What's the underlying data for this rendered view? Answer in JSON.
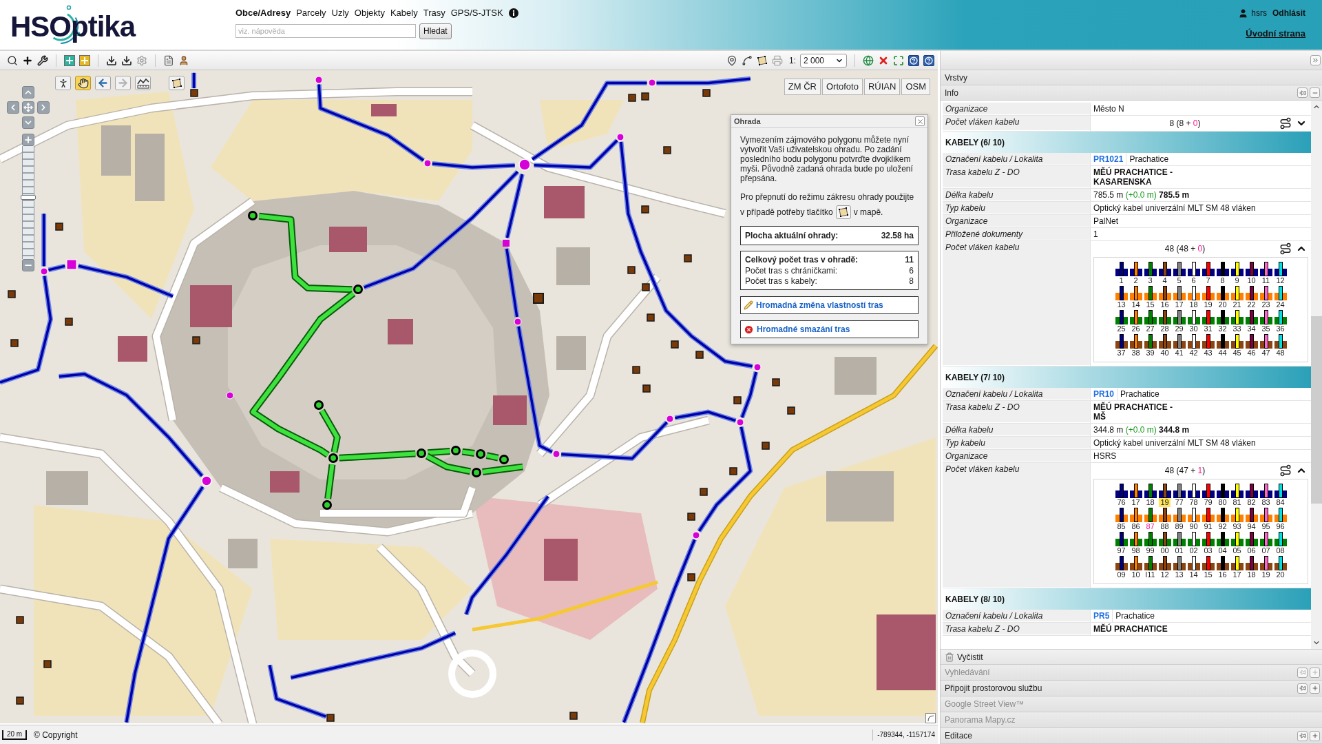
{
  "header": {
    "logo": "HSOptika",
    "nav": [
      {
        "label": "Obce/Adresy",
        "selected": true
      },
      {
        "label": "Parcely",
        "selected": false
      },
      {
        "label": "Uzly",
        "selected": false
      },
      {
        "label": "Objekty",
        "selected": false
      },
      {
        "label": "Kabely",
        "selected": false
      },
      {
        "label": "Trasy",
        "selected": false
      },
      {
        "label": "GPS/S-JTSK",
        "selected": false
      }
    ],
    "search": {
      "placeholder": "viz. nápověda"
    },
    "search_button": "Hledat",
    "user": "hsrs",
    "logout": "Odhlásit",
    "home_link": "Úvodní strana"
  },
  "map": {
    "scale": {
      "prefix": "1:",
      "value": "2 000"
    },
    "tools": [
      {
        "kind": "pegman",
        "selected": false,
        "disabled": false
      },
      {
        "kind": "pan",
        "selected": true,
        "disabled": false
      },
      {
        "kind": "back",
        "selected": false,
        "disabled": false
      },
      {
        "kind": "forward",
        "selected": false,
        "disabled": true
      },
      {
        "kind": "measure",
        "selected": false,
        "disabled": false
      },
      {
        "kind": "polygon",
        "selected": false,
        "disabled": false
      }
    ],
    "zoom_slider": {
      "level": 0.55
    },
    "layers": [
      "ZM ČR",
      "Ortofoto",
      "RÚIAN",
      "OSM"
    ],
    "fence_dialog": {
      "title": "Ohrada",
      "text": "Vymezením zájmového polygonu můžete nyní vytvořit Vaši uživatelskou ohradu. Po zadání posledního bodu polygonu potvrďte dvojklikem myši. Původně zadaná ohrada bude po uložení přepsána.",
      "hint_intro": "Pro přepnutí do režimu zákresu ohrady použijte",
      "hint_before": "v případě potřeby tlačítko",
      "hint_after": "v mapě.",
      "area": {
        "label": "Plocha aktuální ohrady:",
        "value": "32.58 ha"
      },
      "counts": [
        {
          "kind": "total",
          "label": "Celkový počet tras v ohradě:",
          "value": "11"
        },
        {
          "kind": "detail",
          "label": "Počet tras s chráničkami:",
          "value": "6"
        },
        {
          "kind": "detail",
          "label": "Počet tras s kabely:",
          "value": "8"
        }
      ],
      "actions": [
        {
          "kind": "edit",
          "label": "Hromadná změna vlastností tras"
        },
        {
          "kind": "delete",
          "label": "Hromadné smazání tras"
        }
      ]
    }
  },
  "status_bar": {
    "scale_bar": "20 m",
    "copyright": "© Copyright",
    "coordinates": "-789344, -1157174"
  },
  "side_panel": {
    "panels": [
      {
        "title": "Vrstvy",
        "pin_controls": false,
        "disabled": false
      },
      {
        "title": "Info",
        "pin_controls": true,
        "expanded": true,
        "disabled": false,
        "clear_button": "Vyčistit",
        "sections": [
          {
            "rows": [
              {
                "kind": "text",
                "label": "Organizace",
                "value": "Město N"
              },
              {
                "kind": "fibers",
                "label": "Počet vláken kabelu",
                "count": {
                  "before": "8 (8 + ",
                  "extra": "0",
                  "after": ")"
                },
                "expanded": false
              }
            ]
          },
          {
            "title": "KABELY (6/ 10)",
            "rows": [
              {
                "kind": "cable",
                "label": "Označení kabelu / Lokalita",
                "cable": "PR1021",
                "locality": "Prachatice"
              },
              {
                "kind": "route",
                "label": "Trasa kabelu Z - DO",
                "lines": [
                  "MĚÚ PRACHATICE -",
                  "KASARENSKA"
                ]
              },
              {
                "kind": "length",
                "label": "Délka kabelu",
                "value": "785.5 m",
                "delta": "(+0.0 m)",
                "total": "785.5 m"
              },
              {
                "kind": "text",
                "label": "Typ kabelu",
                "value": "Optický kabel univerzální MLT SM 48 vláken"
              },
              {
                "kind": "text",
                "label": "Organizace",
                "value": "PalNet"
              },
              {
                "kind": "text",
                "label": "Přiložené dokumenty",
                "value": "1"
              },
              {
                "kind": "fibers",
                "label": "Počet vláken kabelu",
                "count": {
                  "before": "48 (48 + ",
                  "extra": "0",
                  "after": ")"
                },
                "expanded": true,
                "tubes": [
                  {
                    "color": "#000080",
                    "fibers": [
                      {
                        "label": "1",
                        "color": "#000080",
                        "highlighted": false,
                        "flagged": false
                      },
                      {
                        "label": "2",
                        "color": "#ff8000",
                        "highlighted": false,
                        "flagged": false
                      },
                      {
                        "label": "3",
                        "color": "#008000",
                        "highlighted": false,
                        "flagged": false
                      },
                      {
                        "label": "4",
                        "color": "#8b4513",
                        "highlighted": false,
                        "flagged": false
                      },
                      {
                        "label": "5",
                        "color": "#808080",
                        "highlighted": false,
                        "flagged": false
                      },
                      {
                        "label": "6",
                        "color": "#ffffff",
                        "highlighted": false,
                        "flagged": false
                      },
                      {
                        "label": "7",
                        "color": "#ff0000",
                        "highlighted": false,
                        "flagged": false
                      },
                      {
                        "label": "8",
                        "color": "#000000",
                        "highlighted": false,
                        "flagged": false
                      },
                      {
                        "label": "9",
                        "color": "#ffff00",
                        "highlighted": false,
                        "flagged": false
                      },
                      {
                        "label": "10",
                        "color": "#800040",
                        "highlighted": false,
                        "flagged": false
                      },
                      {
                        "label": "11",
                        "color": "#ff66cc",
                        "highlighted": false,
                        "flagged": false
                      },
                      {
                        "label": "12",
                        "color": "#00e0e0",
                        "highlighted": false,
                        "flagged": false
                      }
                    ]
                  },
                  {
                    "color": "#ff8000",
                    "fibers": [
                      {
                        "label": "13",
                        "color": "#000080",
                        "highlighted": false,
                        "flagged": false
                      },
                      {
                        "label": "14",
                        "color": "#ff8000",
                        "highlighted": false,
                        "flagged": false
                      },
                      {
                        "label": "15",
                        "color": "#008000",
                        "highlighted": false,
                        "flagged": false
                      },
                      {
                        "label": "16",
                        "color": "#8b4513",
                        "highlighted": false,
                        "flagged": false
                      },
                      {
                        "label": "17",
                        "color": "#808080",
                        "highlighted": false,
                        "flagged": false
                      },
                      {
                        "label": "18",
                        "color": "#ffffff",
                        "highlighted": false,
                        "flagged": false
                      },
                      {
                        "label": "19",
                        "color": "#ff0000",
                        "highlighted": false,
                        "flagged": false
                      },
                      {
                        "label": "20",
                        "color": "#000000",
                        "highlighted": false,
                        "flagged": false
                      },
                      {
                        "label": "21",
                        "color": "#ffff00",
                        "highlighted": false,
                        "flagged": false
                      },
                      {
                        "label": "22",
                        "color": "#800040",
                        "highlighted": false,
                        "flagged": false
                      },
                      {
                        "label": "23",
                        "color": "#ff66cc",
                        "highlighted": false,
                        "flagged": false
                      },
                      {
                        "label": "24",
                        "color": "#00e0e0",
                        "highlighted": false,
                        "flagged": false
                      }
                    ]
                  },
                  {
                    "color": "#008000",
                    "fibers": [
                      {
                        "label": "25",
                        "color": "#000080",
                        "highlighted": false,
                        "flagged": false
                      },
                      {
                        "label": "26",
                        "color": "#ff8000",
                        "highlighted": false,
                        "flagged": false
                      },
                      {
                        "label": "27",
                        "color": "#008000",
                        "highlighted": false,
                        "flagged": false
                      },
                      {
                        "label": "28",
                        "color": "#8b4513",
                        "highlighted": false,
                        "flagged": false
                      },
                      {
                        "label": "29",
                        "color": "#808080",
                        "highlighted": false,
                        "flagged": false
                      },
                      {
                        "label": "30",
                        "color": "#ffffff",
                        "highlighted": false,
                        "flagged": false
                      },
                      {
                        "label": "31",
                        "color": "#ff0000",
                        "highlighted": false,
                        "flagged": false
                      },
                      {
                        "label": "32",
                        "color": "#000000",
                        "highlighted": false,
                        "flagged": false
                      },
                      {
                        "label": "33",
                        "color": "#ffff00",
                        "highlighted": false,
                        "flagged": false
                      },
                      {
                        "label": "34",
                        "color": "#800040",
                        "highlighted": false,
                        "flagged": false
                      },
                      {
                        "label": "35",
                        "color": "#ff66cc",
                        "highlighted": false,
                        "flagged": false
                      },
                      {
                        "label": "36",
                        "color": "#00e0e0",
                        "highlighted": false,
                        "flagged": false
                      }
                    ]
                  },
                  {
                    "color": "#8b4513",
                    "fibers": [
                      {
                        "label": "37",
                        "color": "#000080",
                        "highlighted": false,
                        "flagged": false
                      },
                      {
                        "label": "38",
                        "color": "#ff8000",
                        "highlighted": false,
                        "flagged": false
                      },
                      {
                        "label": "39",
                        "color": "#008000",
                        "highlighted": false,
                        "flagged": false
                      },
                      {
                        "label": "40",
                        "color": "#8b4513",
                        "highlighted": false,
                        "flagged": false
                      },
                      {
                        "label": "41",
                        "color": "#808080",
                        "highlighted": false,
                        "flagged": false
                      },
                      {
                        "label": "42",
                        "color": "#ffffff",
                        "highlighted": false,
                        "flagged": false
                      },
                      {
                        "label": "43",
                        "color": "#ff0000",
                        "highlighted": false,
                        "flagged": false
                      },
                      {
                        "label": "44",
                        "color": "#000000",
                        "highlighted": false,
                        "flagged": false
                      },
                      {
                        "label": "45",
                        "color": "#ffff00",
                        "highlighted": false,
                        "flagged": false
                      },
                      {
                        "label": "46",
                        "color": "#800040",
                        "highlighted": false,
                        "flagged": false
                      },
                      {
                        "label": "47",
                        "color": "#ff66cc",
                        "highlighted": false,
                        "flagged": false
                      },
                      {
                        "label": "48",
                        "color": "#00e0e0",
                        "highlighted": false,
                        "flagged": false
                      }
                    ]
                  }
                ]
              }
            ]
          },
          {
            "title": "KABELY (7/ 10)",
            "rows": [
              {
                "kind": "cable",
                "label": "Označení kabelu / Lokalita",
                "cable": "PR10",
                "locality": "Prachatice"
              },
              {
                "kind": "route",
                "label": "Trasa kabelu Z - DO",
                "lines": [
                  "MĚÚ PRACHATICE -",
                  "MŠ"
                ]
              },
              {
                "kind": "length",
                "label": "Délka kabelu",
                "value": "344.8 m",
                "delta": "(+0.0 m)",
                "total": "344.8 m"
              },
              {
                "kind": "text",
                "label": "Typ kabelu",
                "value": "Optický kabel univerzální MLT SM 48 vláken"
              },
              {
                "kind": "text",
                "label": "Organizace",
                "value": "HSRS"
              },
              {
                "kind": "fibers",
                "label": "Počet vláken kabelu",
                "count": {
                  "before": "48 (47 + ",
                  "extra": "1",
                  "after": ")"
                },
                "expanded": true,
                "tubes": [
                  {
                    "color": "#000080",
                    "fibers": [
                      {
                        "label": "76",
                        "color": "#000080",
                        "highlighted": false,
                        "flagged": false
                      },
                      {
                        "label": "17",
                        "color": "#ff8000",
                        "highlighted": false,
                        "flagged": false
                      },
                      {
                        "label": "18",
                        "color": "#008000",
                        "highlighted": false,
                        "flagged": false
                      },
                      {
                        "label": "19",
                        "color": "#8b4513",
                        "highlighted": true,
                        "flagged": false
                      },
                      {
                        "label": "77",
                        "color": "#808080",
                        "highlighted": false,
                        "flagged": false
                      },
                      {
                        "label": "78",
                        "color": "#ffffff",
                        "highlighted": false,
                        "flagged": false
                      },
                      {
                        "label": "79",
                        "color": "#ff0000",
                        "highlighted": false,
                        "flagged": false
                      },
                      {
                        "label": "80",
                        "color": "#000000",
                        "highlighted": false,
                        "flagged": false
                      },
                      {
                        "label": "81",
                        "color": "#ffff00",
                        "highlighted": false,
                        "flagged": false
                      },
                      {
                        "label": "82",
                        "color": "#800040",
                        "highlighted": false,
                        "flagged": false
                      },
                      {
                        "label": "83",
                        "color": "#ff66cc",
                        "highlighted": false,
                        "flagged": false
                      },
                      {
                        "label": "84",
                        "color": "#00e0e0",
                        "highlighted": false,
                        "flagged": false
                      }
                    ]
                  },
                  {
                    "color": "#ff8000",
                    "fibers": [
                      {
                        "label": "85",
                        "color": "#000080",
                        "highlighted": false,
                        "flagged": false
                      },
                      {
                        "label": "86",
                        "color": "#ff8000",
                        "highlighted": false,
                        "flagged": false
                      },
                      {
                        "label": "87",
                        "color": "#008000",
                        "highlighted": false,
                        "flagged": true
                      },
                      {
                        "label": "88",
                        "color": "#8b4513",
                        "highlighted": false,
                        "flagged": false
                      },
                      {
                        "label": "89",
                        "color": "#808080",
                        "highlighted": false,
                        "flagged": false
                      },
                      {
                        "label": "90",
                        "color": "#ffffff",
                        "highlighted": false,
                        "flagged": false
                      },
                      {
                        "label": "91",
                        "color": "#ff0000",
                        "highlighted": false,
                        "flagged": false
                      },
                      {
                        "label": "92",
                        "color": "#000000",
                        "highlighted": false,
                        "flagged": false
                      },
                      {
                        "label": "93",
                        "color": "#ffff00",
                        "highlighted": false,
                        "flagged": false
                      },
                      {
                        "label": "94",
                        "color": "#800040",
                        "highlighted": false,
                        "flagged": false
                      },
                      {
                        "label": "95",
                        "color": "#ff66cc",
                        "highlighted": false,
                        "flagged": false
                      },
                      {
                        "label": "96",
                        "color": "#00e0e0",
                        "highlighted": false,
                        "flagged": false
                      }
                    ]
                  },
                  {
                    "color": "#008000",
                    "fibers": [
                      {
                        "label": "97",
                        "color": "#000080",
                        "highlighted": false,
                        "flagged": false
                      },
                      {
                        "label": "98",
                        "color": "#ff8000",
                        "highlighted": false,
                        "flagged": false
                      },
                      {
                        "label": "99",
                        "color": "#008000",
                        "highlighted": false,
                        "flagged": false
                      },
                      {
                        "label": "00",
                        "color": "#8b4513",
                        "highlighted": false,
                        "flagged": false
                      },
                      {
                        "label": "01",
                        "color": "#808080",
                        "highlighted": false,
                        "flagged": false
                      },
                      {
                        "label": "02",
                        "color": "#ffffff",
                        "highlighted": false,
                        "flagged": false
                      },
                      {
                        "label": "03",
                        "color": "#ff0000",
                        "highlighted": false,
                        "flagged": false
                      },
                      {
                        "label": "04",
                        "color": "#000000",
                        "highlighted": false,
                        "flagged": false
                      },
                      {
                        "label": "05",
                        "color": "#ffff00",
                        "highlighted": false,
                        "flagged": false
                      },
                      {
                        "label": "06",
                        "color": "#800040",
                        "highlighted": false,
                        "flagged": false
                      },
                      {
                        "label": "07",
                        "color": "#ff66cc",
                        "highlighted": false,
                        "flagged": false
                      },
                      {
                        "label": "08",
                        "color": "#00e0e0",
                        "highlighted": false,
                        "flagged": false
                      }
                    ]
                  },
                  {
                    "color": "#8b4513",
                    "fibers": [
                      {
                        "label": "09",
                        "color": "#000080",
                        "highlighted": false,
                        "flagged": false
                      },
                      {
                        "label": "10",
                        "color": "#ff8000",
                        "highlighted": false,
                        "flagged": false
                      },
                      {
                        "label": "I11",
                        "color": "#008000",
                        "highlighted": false,
                        "flagged": false
                      },
                      {
                        "label": "12",
                        "color": "#8b4513",
                        "highlighted": false,
                        "flagged": false
                      },
                      {
                        "label": "13",
                        "color": "#808080",
                        "highlighted": false,
                        "flagged": false
                      },
                      {
                        "label": "14",
                        "color": "#ffffff",
                        "highlighted": false,
                        "flagged": false
                      },
                      {
                        "label": "15",
                        "color": "#ff0000",
                        "highlighted": false,
                        "flagged": false
                      },
                      {
                        "label": "16",
                        "color": "#000000",
                        "highlighted": false,
                        "flagged": false
                      },
                      {
                        "label": "17",
                        "color": "#ffff00",
                        "highlighted": false,
                        "flagged": false
                      },
                      {
                        "label": "18",
                        "color": "#800040",
                        "highlighted": false,
                        "flagged": false
                      },
                      {
                        "label": "19",
                        "color": "#ff66cc",
                        "highlighted": false,
                        "flagged": false
                      },
                      {
                        "label": "20",
                        "color": "#00e0e0",
                        "highlighted": false,
                        "flagged": false
                      }
                    ]
                  }
                ]
              }
            ]
          },
          {
            "title": "KABELY (8/ 10)",
            "rows": [
              {
                "kind": "cable",
                "label": "Označení kabelu / Lokalita",
                "cable": "PR5",
                "locality": "Prachatice"
              },
              {
                "kind": "route",
                "label": "Trasa kabelu Z - DO",
                "lines": [
                  "MĚÚ PRACHATICE"
                ]
              }
            ]
          }
        ]
      },
      {
        "title": "Vyhledávání",
        "pin_controls": true,
        "expanded": false,
        "disabled": true
      },
      {
        "title": "Připojit prostorovou službu",
        "pin_controls": true,
        "expanded": false,
        "disabled": false
      },
      {
        "title": "Google Street View™",
        "pin_controls": false,
        "disabled": true
      },
      {
        "title": "Panorama Mapy.cz",
        "pin_controls": false,
        "disabled": true
      },
      {
        "title": "Editace",
        "pin_controls": true,
        "expanded": false,
        "disabled": false
      }
    ]
  }
}
